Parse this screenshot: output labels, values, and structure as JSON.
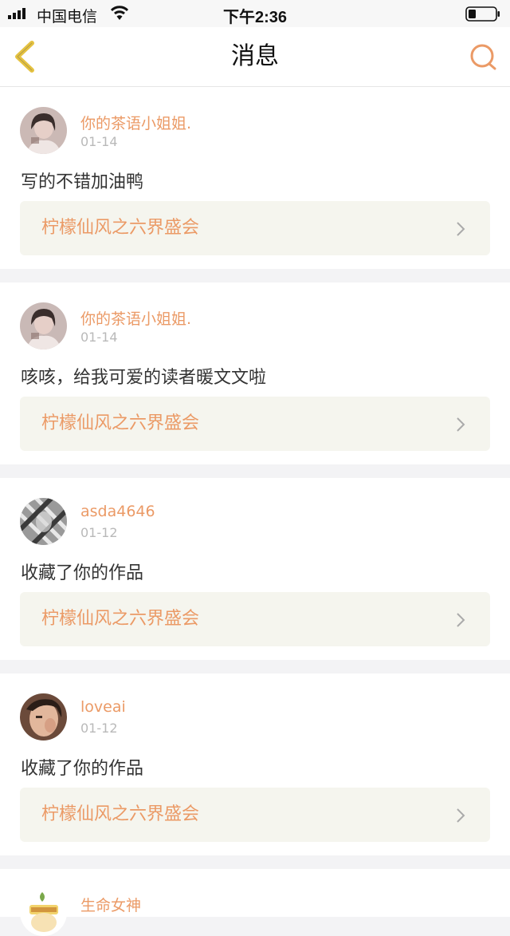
{
  "status_bar": {
    "carrier": "中国电信",
    "time": "下午2:36"
  },
  "nav": {
    "title": "消息"
  },
  "colors": {
    "accent": "#eb9a66",
    "back_arrow": "#e5c240",
    "card_link_bg": "#f5f5ee"
  },
  "messages": [
    {
      "user": "你的茶语小姐姐.",
      "date": "01-14",
      "text": "写的不错加油鸭",
      "work": "柠檬仙风之六界盛会",
      "avatar": "girl-photo-avatar"
    },
    {
      "user": "你的茶语小姐姐.",
      "date": "01-14",
      "text": "咳咳，给我可爱的读者暖文文啦",
      "work": "柠檬仙风之六界盛会",
      "avatar": "girl-photo-avatar"
    },
    {
      "user": "asda4646",
      "date": "01-12",
      "text": "收藏了你的作品",
      "work": "柠檬仙风之六界盛会",
      "avatar": "bw-photo-avatar"
    },
    {
      "user": "loveai",
      "date": "01-12",
      "text": "收藏了你的作品",
      "work": "柠檬仙风之六界盛会",
      "avatar": "selfie-avatar"
    },
    {
      "user": "生命女神",
      "avatar": "cartoon-avatar"
    }
  ]
}
